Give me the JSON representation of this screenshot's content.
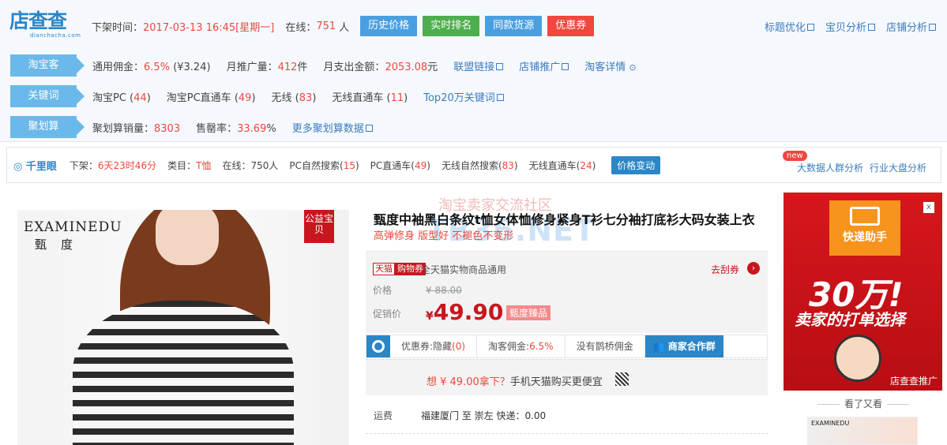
{
  "plugin": {
    "logo_text": "店查查",
    "logo_sub": "dianchacha.com",
    "offshelf_label": "下架时间：",
    "offshelf_value": "2017-03-13 16:45[星期一]",
    "online_label": "在线：",
    "online_value": "751",
    "online_unit": "人",
    "buttons": [
      {
        "label": "历史价格",
        "color": "#4a9fe0"
      },
      {
        "label": "实时排名",
        "color": "#4cae4c"
      },
      {
        "label": "同款货源",
        "color": "#4a9fe0"
      },
      {
        "label": "优惠券",
        "color": "#f0483e"
      }
    ],
    "top_links": [
      "标题优化",
      "宝贝分析",
      "店铺分析"
    ],
    "rows": {
      "taoke": {
        "tag": "淘宝客",
        "commission_label": "通用佣金：",
        "commission_value": "6.5%",
        "commission_amt": "(¥3.24)",
        "promo_label": "月推广量：",
        "promo_value": "412",
        "promo_unit": "件",
        "spend_label": "月支出金额：",
        "spend_value": "2053.08",
        "spend_unit": "元",
        "link1": "联盟链接",
        "link2": "店铺推广",
        "link3": "淘客详情"
      },
      "keywords": {
        "tag": "关键词",
        "items": [
          {
            "label": "淘宝PC",
            "count": "44"
          },
          {
            "label": "淘宝PC直通车",
            "count": "49"
          },
          {
            "label": "无线",
            "count": "83"
          },
          {
            "label": "无线直通车",
            "count": "11"
          }
        ],
        "top_link": "Top20万关键词"
      },
      "juhuasuan": {
        "tag": "聚划算",
        "sales_label": "聚划算销量：",
        "sales_value": "8303",
        "sellout_label": "售罄率：",
        "sellout_value": "33.69",
        "sellout_unit": "%",
        "more_link": "更多聚划算数据"
      }
    }
  },
  "qlx": {
    "logo": "千里眼",
    "offshelf_label": "下架：",
    "offshelf_value": "6天23时46分",
    "category_label": "类目：",
    "category_value": "T恤",
    "online_label": "在线：",
    "online_value": "750人",
    "items": [
      {
        "label": "PC自然搜索",
        "count": "15"
      },
      {
        "label": "PC直通车",
        "count": "49"
      },
      {
        "label": "无线自然搜索",
        "count": "83"
      },
      {
        "label": "无线直通车",
        "count": "24"
      }
    ],
    "price_btn": "价格变动",
    "new_badge": "new",
    "right_links": [
      "大数据人群分析",
      "行业大盘分析"
    ]
  },
  "product": {
    "brand_en": "EXAMINEDU",
    "brand_cn": "甄度",
    "charity_tag": "公益宝贝",
    "title": "甄度中袖黑白条纹t恤女体恤修身紧身T衫七分袖打底衫大码女装上衣",
    "subtitle": "高弹修身 版型好 不褪色不变形",
    "watermark_top": "淘宝卖家交流社区",
    "watermark_big": "TB36.NET"
  },
  "pricebox": {
    "tmall_tag": "天猫",
    "coupon_tag": "购物券",
    "all_cat": "全天猫实物商品通用",
    "guaquan": "去刮券",
    "price_label": "价格",
    "price_value": "¥ 88.00",
    "promo_label": "促销价",
    "promo_currency": "¥",
    "promo_value": "49.90",
    "promo_tag": "甄度臻品"
  },
  "coupons": {
    "hidden_label": "优惠券:隐藏",
    "hidden_count": "(0)",
    "taoke_label": "淘客佣金:",
    "taoke_value": "6.5%",
    "no_bridge": "没有鹊桥佣金",
    "group": "商家合作群"
  },
  "mobile": {
    "want": "想 ¥ 49.00拿下？",
    "rest": "手机天猫购买更便宜"
  },
  "shipping": {
    "label": "运费",
    "value": "福建厦门 至 崇左 快递：0.00"
  },
  "ad": {
    "brand": "快递助手",
    "big": "30万!",
    "slogan": "卖家的打单选择",
    "close": "x",
    "footer": "店查查推广"
  },
  "sidebar": {
    "see_also": "看了又看",
    "thumb_brand": "EXAMINEDU"
  }
}
